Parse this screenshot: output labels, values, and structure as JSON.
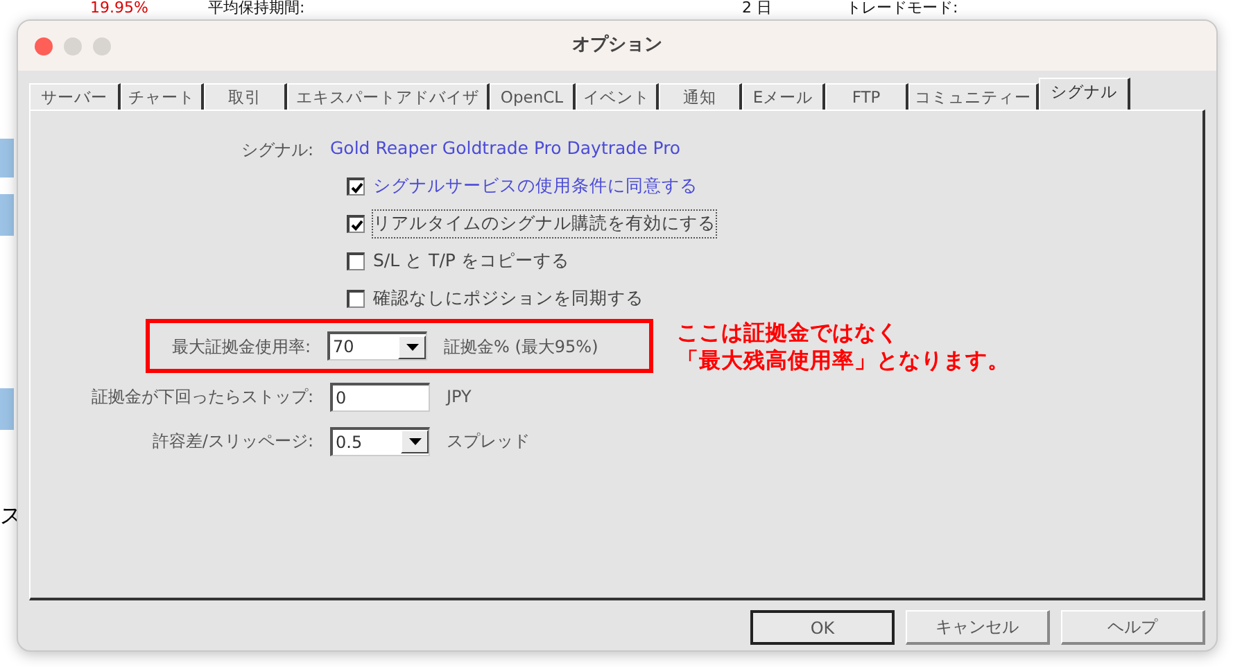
{
  "background": {
    "texts": [
      {
        "text": "19.95%",
        "kind": "negative"
      },
      {
        "text": "平均保持期間:",
        "kind": "label"
      },
      {
        "text": "2 日",
        "kind": "value"
      },
      {
        "text": "トレードモード:",
        "kind": "label"
      }
    ],
    "edge_text": "ス"
  },
  "window": {
    "title": "オプション"
  },
  "tabs": [
    {
      "label": "サーバー",
      "selected": false
    },
    {
      "label": "チャート",
      "selected": false
    },
    {
      "label": "取引",
      "selected": false
    },
    {
      "label": "エキスパートアドバイザ",
      "selected": false
    },
    {
      "label": "OpenCL",
      "selected": false
    },
    {
      "label": "イベント",
      "selected": false
    },
    {
      "label": "通知",
      "selected": false
    },
    {
      "label": "Eメール",
      "selected": false
    },
    {
      "label": "FTP",
      "selected": false
    },
    {
      "label": "コミュニティー",
      "selected": false
    },
    {
      "label": "シグナル",
      "selected": true
    }
  ],
  "signal": {
    "label": "シグナル:",
    "value": "Gold Reaper Goldtrade Pro Daytrade Pro"
  },
  "checkboxes": [
    {
      "label": "シグナルサービスの使用条件に同意する",
      "checked": true,
      "kind": "link"
    },
    {
      "label": "リアルタイムのシグナル購読を有効にする",
      "checked": true,
      "kind": "focused"
    },
    {
      "label": "S/L と T/P をコピーする",
      "checked": false,
      "kind": "plain"
    },
    {
      "label": "確認なしにポジションを同期する",
      "checked": false,
      "kind": "plain"
    }
  ],
  "fields": [
    {
      "label": "最大証拠金使用率:",
      "value": "70",
      "kind": "combo",
      "unit": "証拠金% (最大95%)",
      "highlighted": true
    },
    {
      "label": "証拠金が下回ったらストップ:",
      "value": "0",
      "kind": "text",
      "unit": "JPY",
      "highlighted": false
    },
    {
      "label": "許容差/スリッページ:",
      "value": "0.5",
      "kind": "combo",
      "unit": "スプレッド",
      "highlighted": false
    }
  ],
  "annotation": {
    "lines": [
      "ここは証拠金ではなく",
      "「最大残高使用率」となります。"
    ]
  },
  "buttons": [
    {
      "label": "OK",
      "default": true
    },
    {
      "label": "キャンセル",
      "default": false
    },
    {
      "label": "ヘルプ",
      "default": false
    }
  ]
}
